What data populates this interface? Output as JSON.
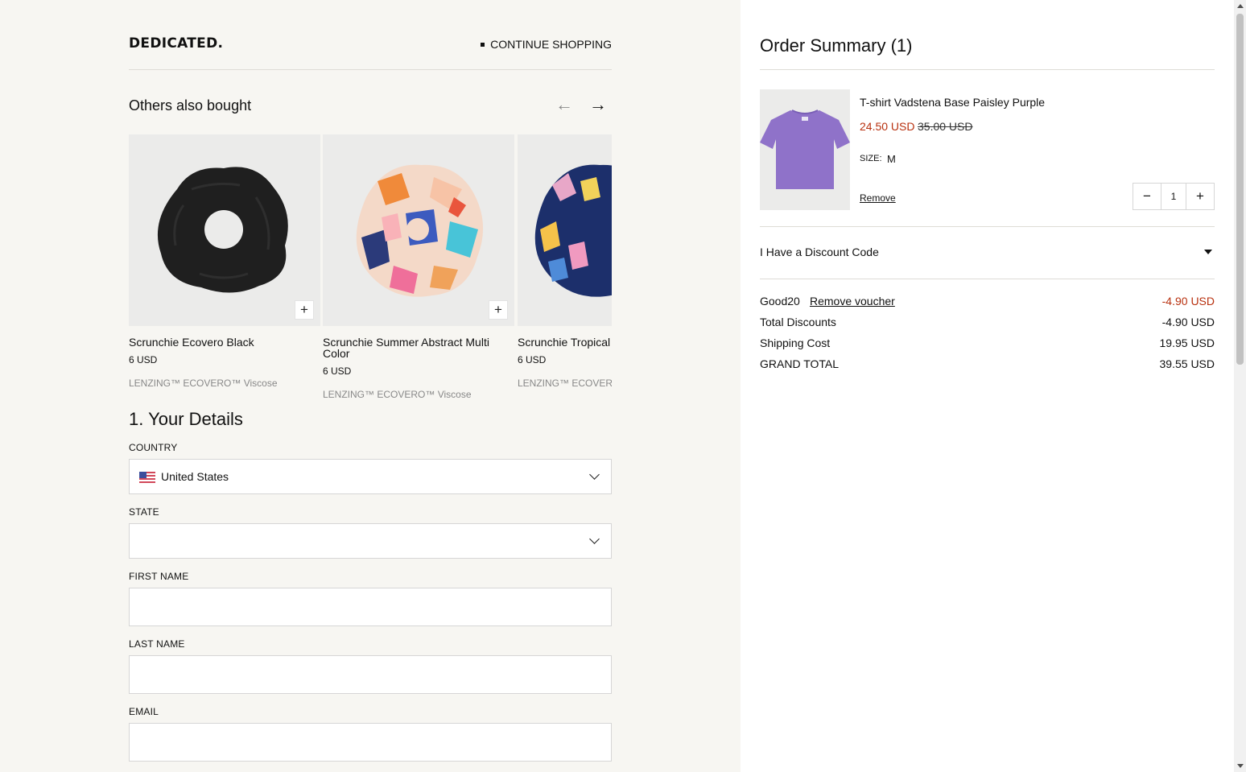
{
  "header": {
    "logo": "DEDICATED.",
    "continue_label": "CONTINUE SHOPPING"
  },
  "others": {
    "title": "Others also bought",
    "prev_icon": "arrow-left-icon",
    "next_icon": "arrow-right-icon",
    "products": [
      {
        "name": "Scrunchie Ecovero Black",
        "price": "6 USD",
        "material": "LENZING™ ECOVERO™ Viscose"
      },
      {
        "name": "Scrunchie Summer Abstract Multi Color",
        "price": "6 USD",
        "material": "LENZING™ ECOVERO™ Viscose"
      },
      {
        "name": "Scrunchie Tropical",
        "price": "6 USD",
        "material": "LENZING™ ECOVERO™ Viscose"
      }
    ]
  },
  "details": {
    "title": "1. Your Details",
    "country_label": "COUNTRY",
    "country_value": "United States",
    "state_label": "STATE",
    "state_value": "",
    "first_name_label": "FIRST NAME",
    "last_name_label": "LAST NAME",
    "email_label": "EMAIL"
  },
  "summary": {
    "title": "Order Summary (1)",
    "item": {
      "name": "T-shirt Vadstena Base Paisley Purple",
      "sale_price": "24.50 USD",
      "original_price": "35.00 USD",
      "size_label": "SIZE:",
      "size_value": "M",
      "remove_label": "Remove",
      "qty": "1",
      "qty_minus": "−",
      "qty_plus": "+"
    },
    "discount_label": "I Have a Discount Code",
    "voucher_code": "Good20",
    "remove_voucher_label": "Remove voucher",
    "voucher_amount": "-4.90 USD",
    "total_discounts_label": "Total Discounts",
    "total_discounts_value": "-4.90 USD",
    "shipping_label": "Shipping Cost",
    "shipping_value": "19.95 USD",
    "grand_total_label": "GRAND TOTAL",
    "grand_total_value": "39.55 USD"
  },
  "colors": {
    "sale_red": "#b8310f",
    "tshirt_purple": "#8f72c9",
    "page_bg": "#f7f6f2"
  }
}
